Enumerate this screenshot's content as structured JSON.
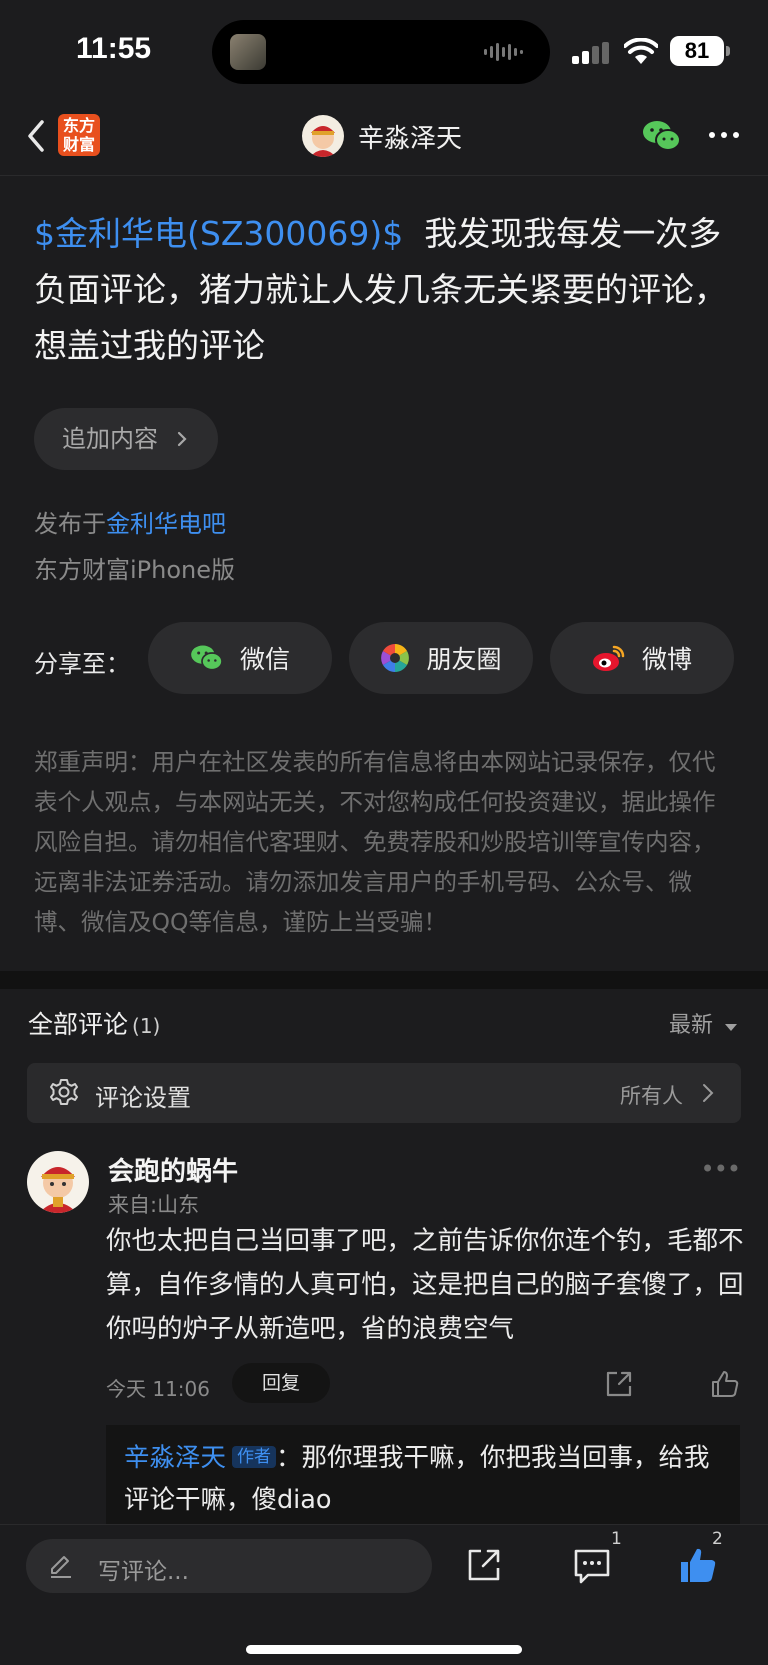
{
  "status_bar": {
    "time": "11:55",
    "battery": "81"
  },
  "header": {
    "logo_line1": "东方",
    "logo_line2": "财富",
    "author_name": "辛淼泽天",
    "wechat_icon": "wechat-icon",
    "more_icon": "more-icon"
  },
  "post": {
    "stock_tag": "$金利华电(SZ300069)$",
    "text": "我发现我每发一次多负面评论，猪力就让人发几条无关紧要的评论，想盖过我的评论",
    "add_content": "追加内容",
    "published_prefix": "发布于",
    "published_bar": "金利华电吧",
    "client": "东方财富iPhone版",
    "share_label": "分享至：",
    "share_wechat": "微信",
    "share_moments": "朋友圈",
    "share_weibo": "微博",
    "disclaimer": "郑重声明：用户在社区发表的所有信息将由本网站记录保存，仅代表个人观点，与本网站无关，不对您构成任何投资建议，据此操作风险自担。请勿相信代客理财、免费荐股和炒股培训等宣传内容，远离非法证券活动。请勿添加发言用户的手机号码、公众号、微博、微信及QQ等信息，谨防上当受骗！"
  },
  "comments": {
    "title": "全部评论",
    "count": "(1)",
    "sort": "最新",
    "settings_label": "评论设置",
    "settings_value": "所有人",
    "items": [
      {
        "user": "会跑的蜗牛",
        "location": "来自:山东",
        "text": "你也太把自己当回事了吧，之前告诉你你连个钓，毛都不算，自作多情的人真可怕，这是把自己的脑子套傻了，回你吗的炉子从新造吧，省的浪费空气",
        "time": "今天 11:06",
        "reply_label": "回复",
        "reply": {
          "user": "辛淼泽天",
          "tag": "作者",
          "text": "：那你理我干嘛，你把我当回事，给我评论干嘛，傻diao"
        }
      }
    ]
  },
  "bottom_bar": {
    "placeholder": "写评论...",
    "comment_count": "1",
    "like_count": "2"
  },
  "colors": {
    "accent_blue": "#3e8ff0",
    "brand_orange": "#e8501e",
    "wechat_green": "#56c75a"
  }
}
